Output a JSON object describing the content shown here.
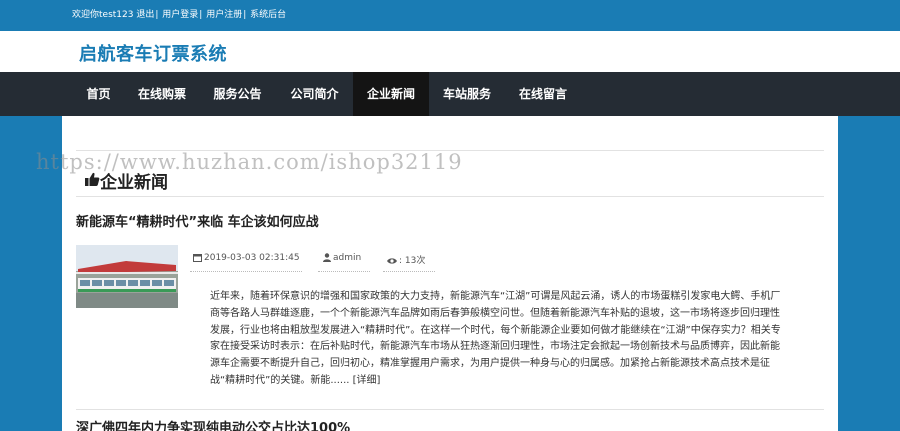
{
  "topbar": {
    "welcome": "欢迎你test123",
    "logout": "退出",
    "login": "用户登录",
    "register": "用户注册",
    "admin": "系统后台"
  },
  "site_title": "启航客车订票系统",
  "nav": {
    "items": [
      {
        "label": "首页",
        "active": false
      },
      {
        "label": "在线购票",
        "active": false
      },
      {
        "label": "服务公告",
        "active": false
      },
      {
        "label": "公司简介",
        "active": false
      },
      {
        "label": "企业新闻",
        "active": true
      },
      {
        "label": "车站服务",
        "active": false
      },
      {
        "label": "在线留言",
        "active": false
      }
    ]
  },
  "watermark": "https://www.huzhan.com/ishop32119",
  "section": {
    "title": "企业新闻",
    "icon": "thumbs-up-icon"
  },
  "news": [
    {
      "title": "新能源车“精耕时代”来临 车企该如何应战",
      "date": "2019-03-03 02:31:45",
      "author": "admin",
      "views": ": 13次",
      "summary": "近年来，随着环保意识的增强和国家政策的大力支持，新能源汽车“江湖”可谓是风起云涌，诱人的市场蛋糕引发家电大鳄、手机厂商等各路人马群雄逐鹿，一个个新能源汽车品牌如雨后春笋般横空问世。但随着新能源汽车补贴的退坡，这一市场将逐步回归理性发展，行业也将由粗放型发展进入“精耕时代”。在这样一个时代，每个新能源企业要如何做才能继续在“江湖”中保存实力？相关专家在接受采访时表示：在后补贴时代，新能源汽车市场从狂热逐渐回归理性，市场注定会掀起一场创新技术与品质博弈，因此新能源车企需要不断提升自己，回归初心，精准掌握用户需求，为用户提供一种身与心的归属感。加紧抢占新能源技术高点技术是征战“精耕时代”的关键。新能......",
      "more": "[详细]"
    },
    {
      "title": "深广佛四年内力争实现纯电动公交占比达100%"
    }
  ],
  "colors": {
    "brand_blue": "#1a7cb4",
    "nav_bg": "#252c34",
    "nav_active": "#141414"
  }
}
